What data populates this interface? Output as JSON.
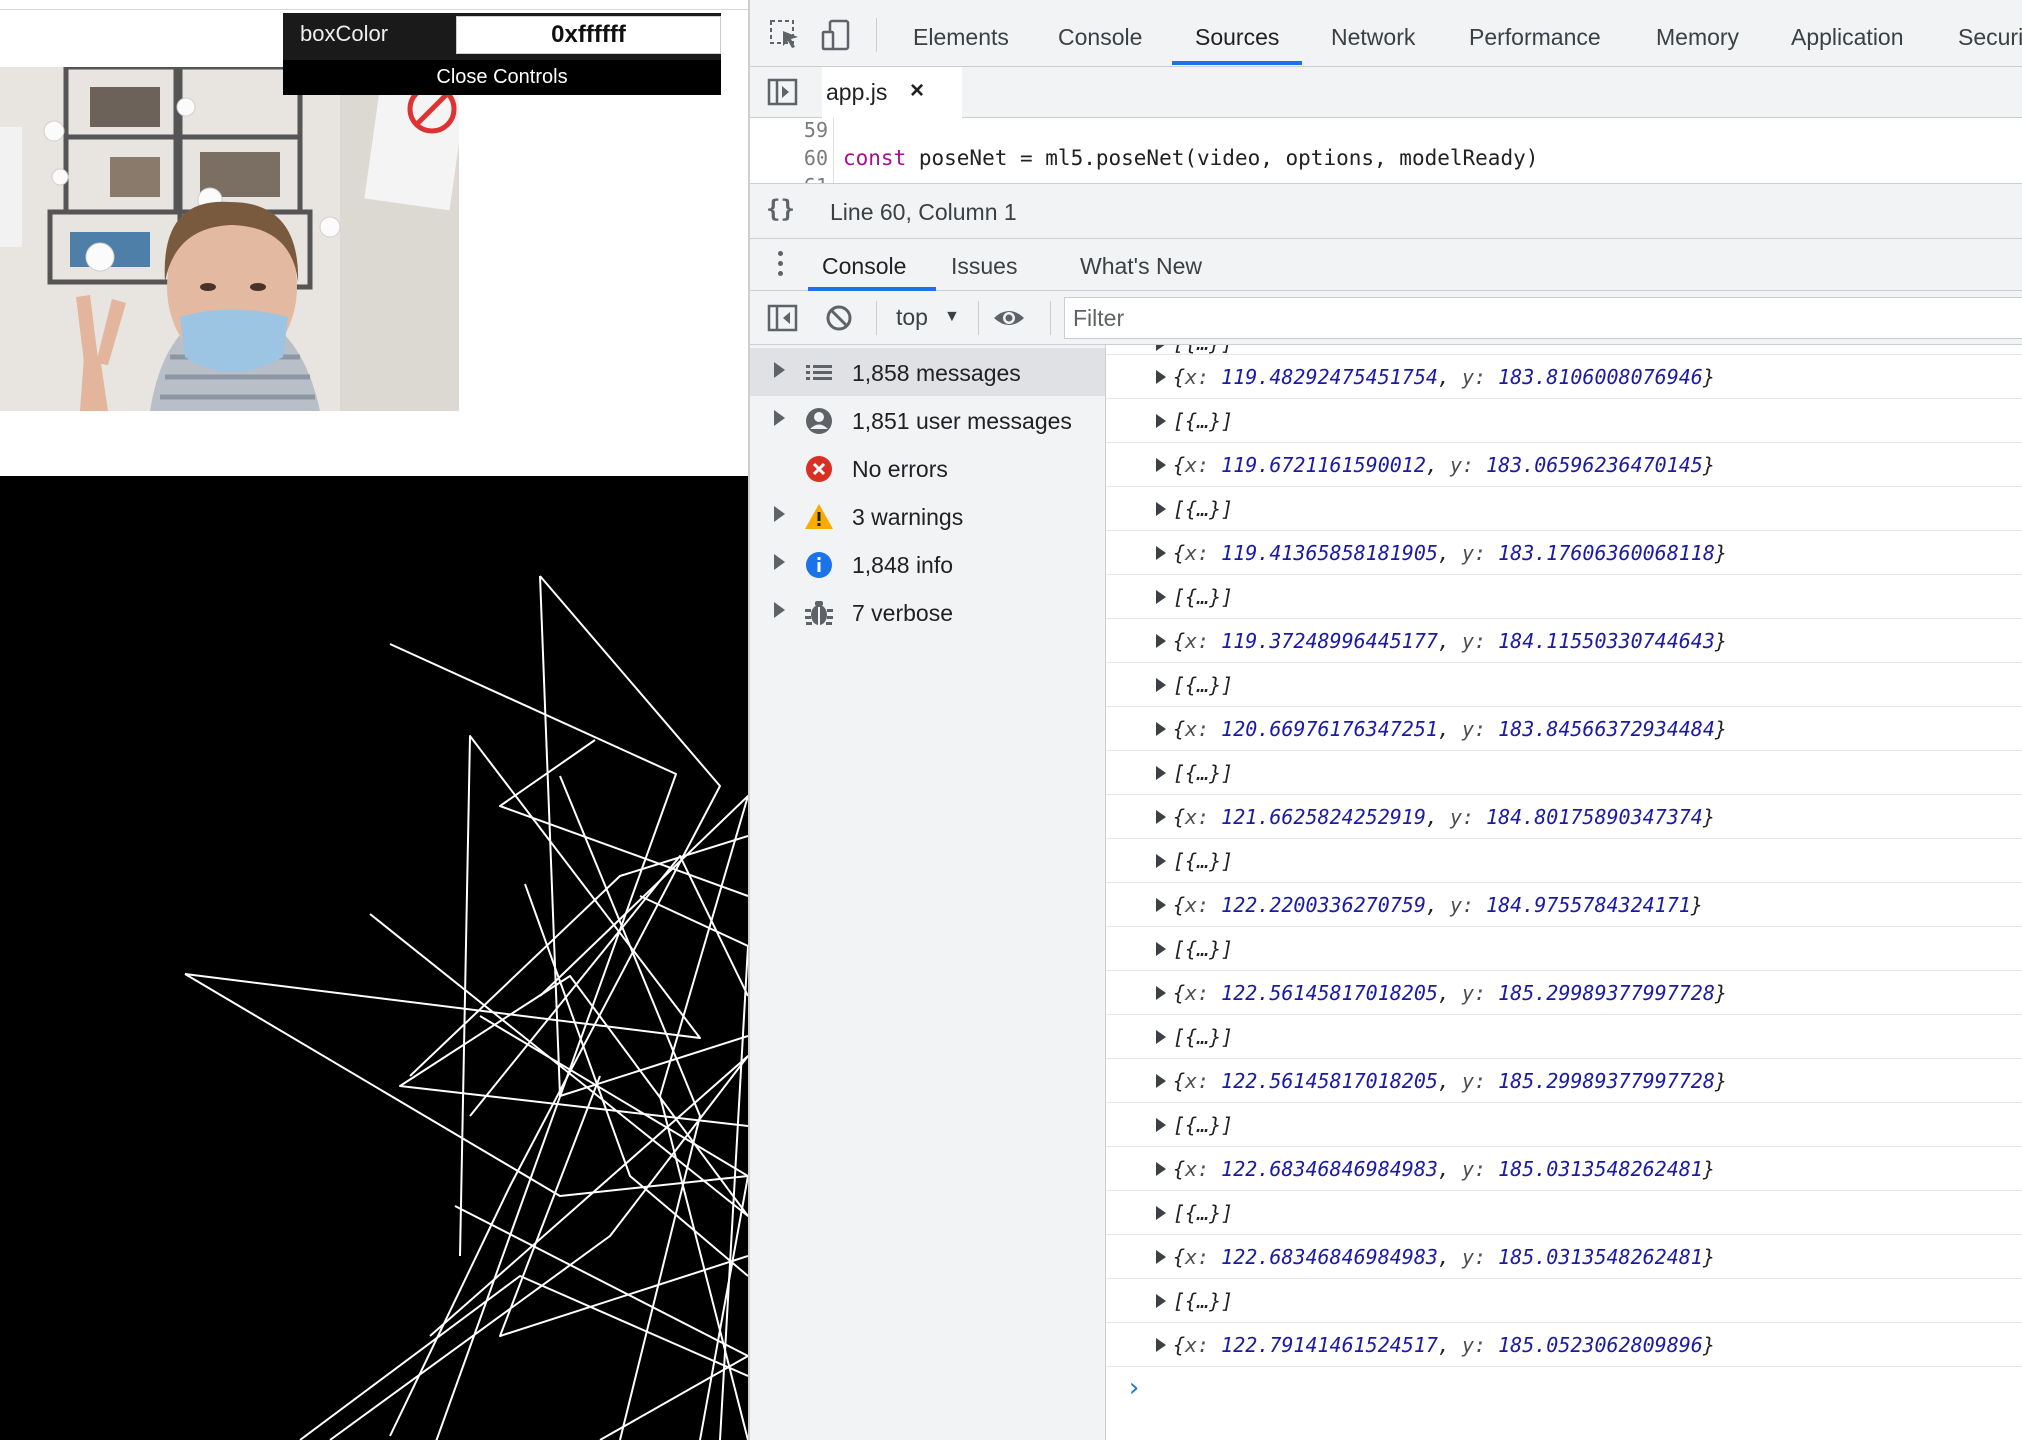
{
  "app": {
    "gui": {
      "label": "boxColor",
      "value": "0xffffff",
      "close_label": "Close Controls"
    }
  },
  "devtools": {
    "tabs": [
      "Elements",
      "Console",
      "Sources",
      "Network",
      "Performance",
      "Memory",
      "Application",
      "Securi"
    ],
    "active_tab": "Sources",
    "file_tab": {
      "name": "app.js",
      "close": "×"
    },
    "code": {
      "lines": [
        {
          "number": "59",
          "text": ""
        },
        {
          "number": "60",
          "keyword": "const",
          "text": " poseNet = ml5.poseNet(video, options, modelReady)"
        }
      ]
    },
    "status": {
      "braces": "{}",
      "position": "Line 60, Column 1"
    },
    "drawer_tabs": [
      "Console",
      "Issues",
      "What's New"
    ],
    "active_drawer_tab": "Console",
    "toolbar": {
      "context": "top",
      "filter_placeholder": "Filter"
    },
    "sidebar": [
      {
        "label": "1,858 messages",
        "icon": "list-icon",
        "expandable": true,
        "selected": true
      },
      {
        "label": "1,851 user messages",
        "icon": "user-icon",
        "expandable": true,
        "selected": false
      },
      {
        "label": "No errors",
        "icon": "error-icon",
        "expandable": false,
        "selected": false
      },
      {
        "label": "3 warnings",
        "icon": "warning-icon",
        "expandable": true,
        "selected": false
      },
      {
        "label": "1,848 info",
        "icon": "info-icon",
        "expandable": true,
        "selected": false
      },
      {
        "label": "7 verbose",
        "icon": "bug-icon",
        "expandable": true,
        "selected": false
      }
    ],
    "log": {
      "partial": "[{…}]",
      "entries": [
        {
          "type": "point",
          "x": "119.48292475451754",
          "y": "183.8106008076946"
        },
        {
          "type": "array",
          "text": "[{…}]"
        },
        {
          "type": "point",
          "x": "119.6721161590012",
          "y": "183.06596236470145"
        },
        {
          "type": "array",
          "text": "[{…}]"
        },
        {
          "type": "point",
          "x": "119.41365858181905",
          "y": "183.17606360068118"
        },
        {
          "type": "array",
          "text": "[{…}]"
        },
        {
          "type": "point",
          "x": "119.37248996445177",
          "y": "184.11550330744643"
        },
        {
          "type": "array",
          "text": "[{…}]"
        },
        {
          "type": "point",
          "x": "120.66976176347251",
          "y": "183.84566372934484"
        },
        {
          "type": "array",
          "text": "[{…}]"
        },
        {
          "type": "point",
          "x": "121.6625824252919",
          "y": "184.80175890347374"
        },
        {
          "type": "array",
          "text": "[{…}]"
        },
        {
          "type": "point",
          "x": "122.2200336270759",
          "y": "184.9755784324171"
        },
        {
          "type": "array",
          "text": "[{…}]"
        },
        {
          "type": "point",
          "x": "122.56145817018205",
          "y": "185.29989377997728"
        },
        {
          "type": "array",
          "text": "[{…}]"
        },
        {
          "type": "point",
          "x": "122.56145817018205",
          "y": "185.29989377997728"
        },
        {
          "type": "array",
          "text": "[{…}]"
        },
        {
          "type": "point",
          "x": "122.68346846984983",
          "y": "185.0313548262481"
        },
        {
          "type": "array",
          "text": "[{…}]"
        },
        {
          "type": "point",
          "x": "122.68346846984983",
          "y": "185.0313548262481"
        },
        {
          "type": "array",
          "text": "[{…}]"
        },
        {
          "type": "point",
          "x": "122.79141461524517",
          "y": "185.0523062809896"
        }
      ],
      "prompt": "›"
    }
  },
  "colors": {
    "accent": "#1a73e8",
    "error": "#d93025",
    "warning": "#f9ab00",
    "info": "#1a73e8",
    "value": "#1a1aa6",
    "keyword": "#aa0d91"
  }
}
